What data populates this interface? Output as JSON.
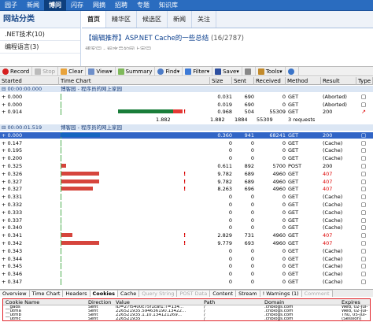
{
  "topnav": [
    "园子",
    "新闻",
    "博问",
    "闪存",
    "网摘",
    "招聘",
    "专题",
    "知识库"
  ],
  "topnav_active": 2,
  "sidebar": {
    "title": "网站分类",
    "items": [
      ".NET技术(10)",
      "编程语言(3)"
    ]
  },
  "tabs": [
    "首页",
    "精华区",
    "候选区",
    "新闻",
    "关注"
  ],
  "tabs_active": 0,
  "headline": {
    "text": "【编辑推荐】ASP.NET Cache的一些总结",
    "count": "(16/2787)"
  },
  "subline": "博客园 - 程序员的网上家园",
  "toolbar": {
    "record": "Record",
    "stop": "Stop",
    "clear": "Clear",
    "view": "View",
    "summary": "Summary",
    "find": "Find",
    "filter": "Filter",
    "save": "Save",
    "tools": "Tools"
  },
  "columns": [
    "Started",
    "Time Chart",
    "Size",
    "Sent",
    "Received",
    "Method",
    "Result",
    "Type"
  ],
  "rows": [
    {
      "kind": "group",
      "started": "00:00:00.000",
      "chart": "博客园 - 程序员的网上家园"
    },
    {
      "started": "+ 0.000",
      "size": "0.031",
      "sent": "690",
      "recv": "0",
      "method": "GET",
      "result": "(Aborted)",
      "type": ""
    },
    {
      "started": "+ 0.000",
      "size": "0.019",
      "sent": "690",
      "recv": "0",
      "method": "GET",
      "result": "(Aborted)",
      "type": ""
    },
    {
      "started": "+ 0.914",
      "size": "0.968",
      "sent": "504",
      "recv": "55309",
      "method": "GET",
      "result": "200",
      "type": "red"
    },
    {
      "kind": "summary",
      "chart_time": "1.882",
      "size": "1.882",
      "sent": "1884",
      "recv": "55309",
      "method": "3 requests"
    },
    {
      "kind": "group",
      "started": "00:00:01.519",
      "chart": "博客园 - 程序员的网上家园"
    },
    {
      "kind": "sel",
      "started": "+ 0.000",
      "size": "0.360",
      "sent": "941",
      "recv": "68241",
      "method": "GET",
      "result": "200",
      "type": ""
    },
    {
      "started": "+ 0.147",
      "size": "0",
      "sent": "0",
      "recv": "0",
      "method": "GET",
      "result": "(Cache)",
      "type": ""
    },
    {
      "started": "+ 0.195",
      "size": "0",
      "sent": "0",
      "recv": "0",
      "method": "GET",
      "result": "(Cache)",
      "type": ""
    },
    {
      "started": "+ 0.200",
      "size": "0",
      "sent": "0",
      "recv": "0",
      "method": "GET",
      "result": "(Cache)",
      "type": ""
    },
    {
      "started": "+ 0.325",
      "size": "0.611",
      "sent": "892",
      "recv": "5700",
      "method": "POST",
      "result": "200",
      "type": ""
    },
    {
      "started": "+ 0.326",
      "size": "9.782",
      "sent": "689",
      "recv": "4960",
      "method": "GET",
      "result": "407",
      "type": ""
    },
    {
      "started": "+ 0.327",
      "size": "9.782",
      "sent": "689",
      "recv": "4960",
      "method": "GET",
      "result": "407",
      "type": ""
    },
    {
      "started": "+ 0.327",
      "size": "8.263",
      "sent": "696",
      "recv": "4960",
      "method": "GET",
      "result": "407",
      "type": ""
    },
    {
      "started": "+ 0.331",
      "size": "0",
      "sent": "0",
      "recv": "0",
      "method": "GET",
      "result": "(Cache)",
      "type": ""
    },
    {
      "started": "+ 0.332",
      "size": "0",
      "sent": "0",
      "recv": "0",
      "method": "GET",
      "result": "(Cache)",
      "type": ""
    },
    {
      "started": "+ 0.333",
      "size": "0",
      "sent": "0",
      "recv": "0",
      "method": "GET",
      "result": "(Cache)",
      "type": ""
    },
    {
      "started": "+ 0.337",
      "size": "0",
      "sent": "0",
      "recv": "0",
      "method": "GET",
      "result": "(Cache)",
      "type": ""
    },
    {
      "started": "+ 0.340",
      "size": "0",
      "sent": "0",
      "recv": "0",
      "method": "GET",
      "result": "(Cache)",
      "type": ""
    },
    {
      "started": "+ 0.341",
      "size": "2.829",
      "sent": "731",
      "recv": "4960",
      "method": "GET",
      "result": "407",
      "type": ""
    },
    {
      "started": "+ 0.342",
      "size": "9.779",
      "sent": "693",
      "recv": "4960",
      "method": "GET",
      "result": "407",
      "type": ""
    },
    {
      "started": "+ 0.343",
      "size": "0",
      "sent": "0",
      "recv": "0",
      "method": "GET",
      "result": "(Cache)",
      "type": ""
    },
    {
      "started": "+ 0.344",
      "size": "0",
      "sent": "0",
      "recv": "0",
      "method": "GET",
      "result": "(Cache)",
      "type": ""
    },
    {
      "started": "+ 0.345",
      "size": "0",
      "sent": "0",
      "recv": "0",
      "method": "GET",
      "result": "(Cache)",
      "type": ""
    },
    {
      "started": "+ 0.346",
      "size": "0",
      "sent": "0",
      "recv": "0",
      "method": "GET",
      "result": "(Cache)",
      "type": ""
    },
    {
      "started": "+ 0.347",
      "size": "0",
      "sent": "0",
      "recv": "0",
      "method": "GET",
      "result": "(Cache)",
      "type": ""
    }
  ],
  "detail_tabs": [
    "Overview",
    "Time Chart",
    "Headers",
    "Cookies",
    "Cache",
    "Query String",
    "POST Data",
    "Content",
    "Stream",
    "! Warnings (1)",
    "Comment"
  ],
  "detail_active": 3,
  "detail_disabled": [
    5,
    6,
    10
  ],
  "cookie_cols": [
    "Cookie Name",
    "Direction",
    "Value",
    "Path",
    "Domain",
    "Expires"
  ],
  "cookies": [
    {
      "name": "__gads",
      "dir": "Sent",
      "value": "ID=27f5400c75f1caf1:T=134...",
      "path": "/",
      "domain": ".cnblogs.com",
      "expires": "Wed, 02-Jul-"
    },
    {
      "name": "__utma",
      "dir": "Sent",
      "value": "226521935.594636190.13422...",
      "path": "/",
      "domain": ".cnblogs.com",
      "expires": "Wed, 02-Jul-"
    },
    {
      "name": "__utmb",
      "dir": "Sent",
      "value": "226521935.1.10.134121269...",
      "path": "/",
      "domain": ".cnblogs.com",
      "expires": "Thu, 05-Jul-"
    },
    {
      "name": "__utmc",
      "dir": "Sent",
      "value": "226521935",
      "path": "/",
      "domain": ".cnblogs.com",
      "expires": "(Session)"
    },
    {
      "name": "__utmz",
      "dir": "Sent",
      "value": "226521935.1341212693.1.1.u...",
      "path": "/",
      "domain": ".cnblogs.com",
      "expires": "Mon, 31-Dec"
    }
  ]
}
